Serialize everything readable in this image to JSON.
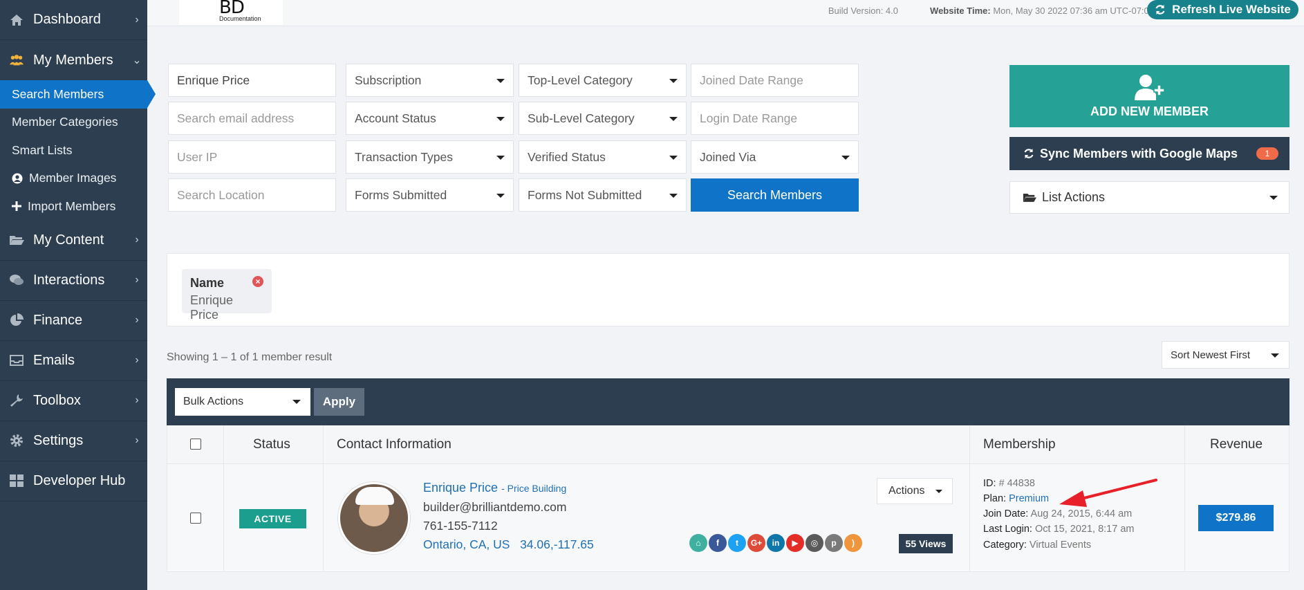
{
  "sidebar": {
    "items": [
      {
        "label": "Dashboard",
        "icon": "home-icon"
      },
      {
        "label": "My Members",
        "icon": "users-icon"
      },
      {
        "label": "My Content",
        "icon": "folder-icon"
      },
      {
        "label": "Interactions",
        "icon": "chat-icon"
      },
      {
        "label": "Finance",
        "icon": "pie-chart-icon"
      },
      {
        "label": "Emails",
        "icon": "inbox-icon"
      },
      {
        "label": "Toolbox",
        "icon": "wrench-icon"
      },
      {
        "label": "Settings",
        "icon": "gear-icon"
      },
      {
        "label": "Developer Hub",
        "icon": "grid-icon"
      }
    ],
    "sub_items": [
      {
        "label": "Search Members"
      },
      {
        "label": "Member Categories"
      },
      {
        "label": "Smart Lists"
      },
      {
        "label": "Member Images",
        "icon": "user-circle-icon"
      },
      {
        "label": "Import Members",
        "icon": "plus-icon"
      }
    ]
  },
  "topbar": {
    "logo": "BD",
    "logo_sub": "Documentation",
    "build": "Build Version: 4.0",
    "website_time_label": "Website Time:",
    "website_time_value": "Mon, May 30 2022 07:36 am UTC-07:00",
    "refresh_label": "Refresh Live Website"
  },
  "search": {
    "name_value": "Enrique Price",
    "email_placeholder": "Search email address",
    "ip_placeholder": "User IP",
    "location_placeholder": "Search Location",
    "subscription": "Subscription",
    "account_status": "Account Status",
    "transaction_types": "Transaction Types",
    "forms_submitted": "Forms Submitted",
    "top_level_category": "Top-Level Category",
    "sub_level_category": "Sub-Level Category",
    "verified_status": "Verified Status",
    "forms_not_submitted": "Forms Not Submitted",
    "joined_date_placeholder": "Joined Date Range",
    "login_date_placeholder": "Login Date Range",
    "joined_via": "Joined Via",
    "search_button": "Search Members"
  },
  "actions": {
    "add_member": "ADD NEW MEMBER",
    "sync": "Sync Members with Google Maps",
    "sync_badge": "1",
    "list_actions": "List Actions"
  },
  "filter": {
    "title": "Name",
    "value": "Enrique Price"
  },
  "results": {
    "showing": "Showing 1 – 1 of 1 member result",
    "sort": "Sort Newest First",
    "bulk_actions": "Bulk Actions",
    "apply": "Apply"
  },
  "table": {
    "headers": {
      "status": "Status",
      "contact": "Contact Information",
      "membership": "Membership",
      "revenue": "Revenue"
    },
    "row": {
      "status": "ACTIVE",
      "name": "Enrique Price",
      "company": "- Price Building",
      "email": "builder@brilliantdemo.com",
      "phone": "761-155-7112",
      "location": "Ontario, CA, US",
      "coords": "34.06,-117.65",
      "actions": "Actions",
      "views": "55 Views",
      "id_label": "ID:",
      "id_value": "# 44838",
      "plan_label": "Plan:",
      "plan_value": "Premium",
      "join_label": "Join Date:",
      "join_value": "Aug 24, 2015, 6:44 am",
      "login_label": "Last Login:",
      "login_value": "Oct 15, 2021, 8:17 am",
      "category_label": "Category:",
      "category_value": "Virtual Events",
      "revenue": "$279.86",
      "socials": [
        {
          "name": "home-icon",
          "color": "#3fb0a0",
          "glyph": "⌂"
        },
        {
          "name": "facebook-icon",
          "color": "#3b5998",
          "glyph": "f"
        },
        {
          "name": "twitter-icon",
          "color": "#1da1f2",
          "glyph": "t"
        },
        {
          "name": "google-plus-icon",
          "color": "#dd4b39",
          "glyph": "G+"
        },
        {
          "name": "linkedin-icon",
          "color": "#0e76a8",
          "glyph": "in"
        },
        {
          "name": "youtube-icon",
          "color": "#e52d27",
          "glyph": "▶"
        },
        {
          "name": "instagram-icon",
          "color": "#5a5a5a",
          "glyph": "◎"
        },
        {
          "name": "pinterest-icon",
          "color": "#7a7a7a",
          "glyph": "p"
        },
        {
          "name": "rss-icon",
          "color": "#f0953b",
          "glyph": ")"
        }
      ]
    }
  }
}
